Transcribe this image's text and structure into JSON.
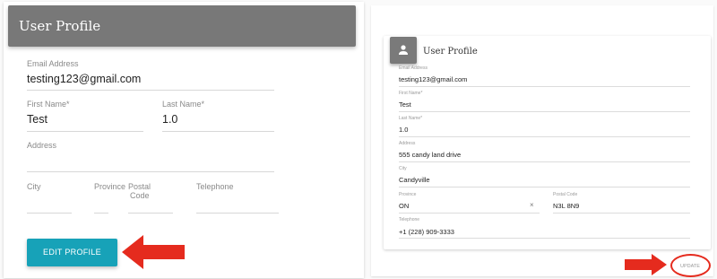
{
  "left": {
    "title": "User Profile",
    "email_label": "Email Address",
    "email_value": "testing123@gmail.com",
    "first_label": "First Name*",
    "first_value": "Test",
    "last_label": "Last Name*",
    "last_value": "1.0",
    "address_label": "Address",
    "city_label": "City",
    "province_label": "Province",
    "postal_label_1": "Postal",
    "postal_label_2": "Code",
    "telephone_label": "Telephone",
    "edit_button": "EDIT PROFILE"
  },
  "right": {
    "title": "User Profile",
    "avatar_icon": "person-icon",
    "email_label": "Email Address",
    "email_value": "testing123@gmail.com",
    "first_label": "First Name*",
    "first_value": "Test",
    "last_label": "Last Name*",
    "last_value": "1.0",
    "address_label": "Address",
    "address_value": "555 candy land drive",
    "city_label": "City",
    "city_value": "Candyville",
    "province_label": "Province",
    "province_value": "ON",
    "clear_glyph": "×",
    "postal_label": "Postal Code",
    "postal_value": "N3L 8N9",
    "telephone_label": "Telephone",
    "telephone_value": "+1 (228) 909-3333",
    "update_button": "UPDATE"
  },
  "colors": {
    "header_gray": "#787878",
    "button_teal": "#17a2b8",
    "arrow_red": "#e52b1e"
  }
}
